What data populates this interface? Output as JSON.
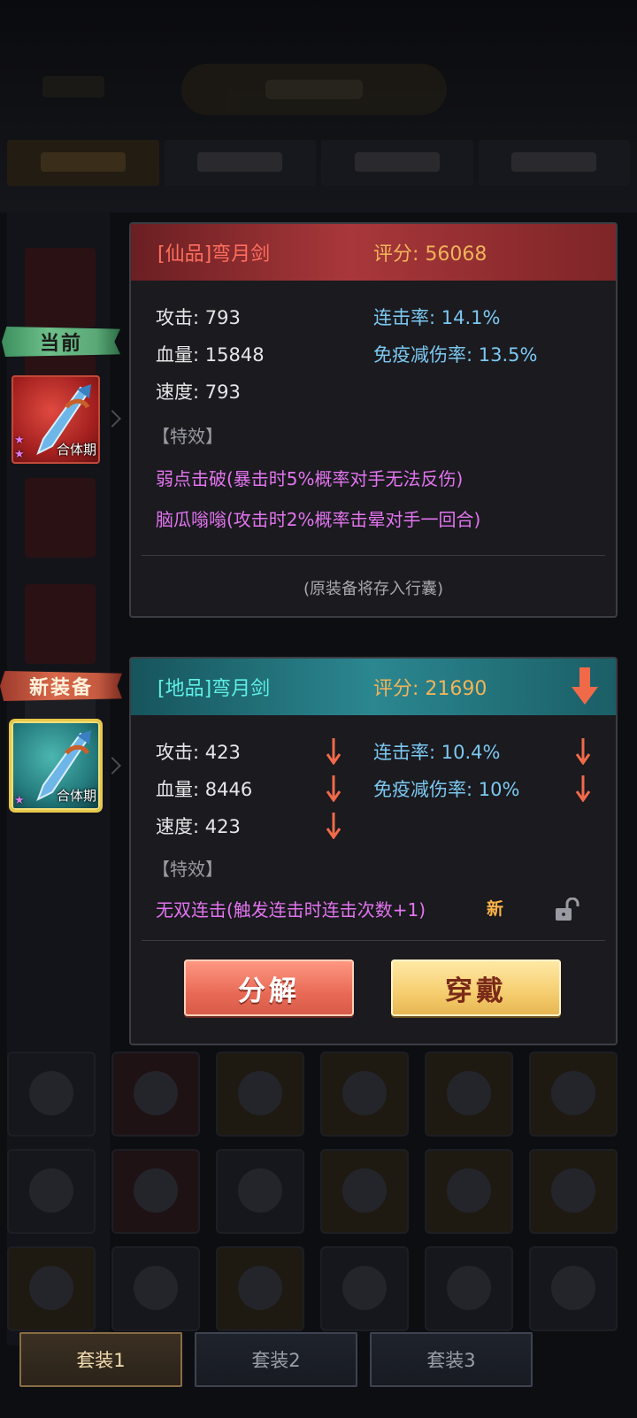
{
  "current_label": "当前",
  "new_label": "新装备",
  "current_item": {
    "tier": "合体期",
    "name": "[仙品]弯月剑",
    "score": "评分: 56068",
    "stats": {
      "attack": "攻击: 793",
      "hp": "血量: 15848",
      "speed": "速度: 793",
      "combo": "连击率: 14.1%",
      "immune": "免疫减伤率: 13.5%"
    },
    "effects_header": "【特效】",
    "effects": [
      "弱点击破(暴击时5%概率对手无法反伤)",
      "脑瓜嗡嗡(攻击时2%概率击晕对手一回合)"
    ],
    "note": "(原装备将存入行囊)"
  },
  "new_item": {
    "tier": "合体期",
    "name": "[地品]弯月剑",
    "score": "评分: 21690",
    "stats": {
      "attack": "攻击: 423",
      "hp": "血量: 8446",
      "speed": "速度: 423",
      "combo": "连击率: 10.4%",
      "immune": "免疫减伤率: 10%"
    },
    "effects_header": "【特效】",
    "effects": [
      "无双连击(触发连击时连击次数+1)"
    ],
    "new_tag": "新"
  },
  "buttons": {
    "decompose": "分解",
    "equip": "穿戴"
  },
  "set_tabs": [
    "套装1",
    "套装2",
    "套装3"
  ],
  "colors": {
    "down_arrow": "#f06a4a",
    "effect_text": "#e274ee",
    "score": "#f0b45a"
  },
  "icons": [
    "down-arrow-icon",
    "unlock-icon",
    "sword-icon",
    "star-icon"
  ]
}
